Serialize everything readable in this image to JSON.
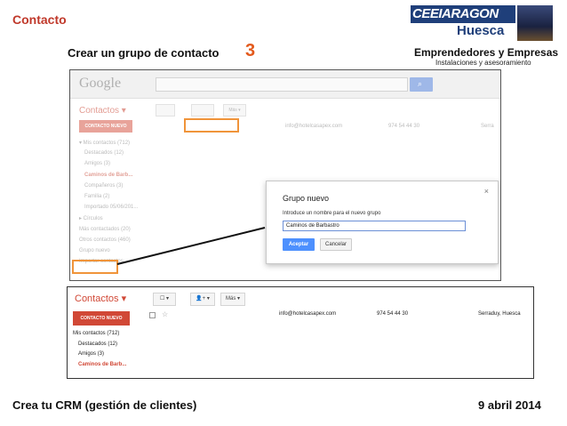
{
  "slide": {
    "title": "Contacto",
    "subtitle": "Crear un grupo de contacto",
    "step": "3",
    "org": "Emprendedores y Empresas",
    "org_sub": "Instalaciones y asesoramiento",
    "logo_line1": "CEEIARAGON",
    "logo_line2": "Huesca",
    "footer_left": "Crea tu CRM (gestión de clientes)",
    "footer_right": "9 abril 2014",
    "accent": "#c0392b",
    "highlight": "#f0943a"
  },
  "shot1": {
    "google": "Google",
    "contacts_label": "Contactos ▾",
    "new_contact": "CONTACTO NUEVO",
    "more": "Más ▾",
    "sidebar": [
      {
        "label": "▾ Mis contactos (712)",
        "indent": false,
        "active": false
      },
      {
        "label": "Destacados (12)",
        "indent": true,
        "active": false
      },
      {
        "label": "Amigos (3)",
        "indent": true,
        "active": false
      },
      {
        "label": "Caminos de Barb...",
        "indent": true,
        "active": true
      },
      {
        "label": "Compañeros (3)",
        "indent": true,
        "active": false
      },
      {
        "label": "Familia (2)",
        "indent": true,
        "active": false
      },
      {
        "label": "Importado 05/06/201...",
        "indent": true,
        "active": false
      },
      {
        "label": "▸ Círculos",
        "indent": false,
        "active": false
      },
      {
        "label": "Más contactados (20)",
        "indent": false,
        "active": false
      },
      {
        "label": "Otros contactos (460)",
        "indent": false,
        "active": false
      },
      {
        "label": "Grupo nuevo",
        "indent": false,
        "active": false
      },
      {
        "label": "Importar contactos",
        "indent": false,
        "active": false
      }
    ],
    "row": {
      "email": "info@hotelcasapex.com",
      "phone": "974 54 44 30",
      "location": "Serra"
    },
    "dialog": {
      "title": "Grupo nuevo",
      "close": "×",
      "label": "Introduce un nombre para el nuevo grupo",
      "value": "Caminos de Barbastro",
      "ok": "Aceptar",
      "cancel": "Cancelar"
    }
  },
  "shot2": {
    "contacts_label": "Contactos ▾",
    "new_contact": "CONTACTO NUEVO",
    "more": "Más ▾",
    "sidebar": [
      {
        "label": "Mis contactos (712)",
        "indent": false,
        "active": false
      },
      {
        "label": "Destacados (12)",
        "indent": true,
        "active": false
      },
      {
        "label": "Amigos (3)",
        "indent": true,
        "active": false
      },
      {
        "label": "Caminos de Barb...",
        "indent": true,
        "active": true
      }
    ],
    "row": {
      "email": "info@hotelcasapex.com",
      "phone": "974 54 44 30",
      "location": "Serraduy, Huesca"
    }
  }
}
